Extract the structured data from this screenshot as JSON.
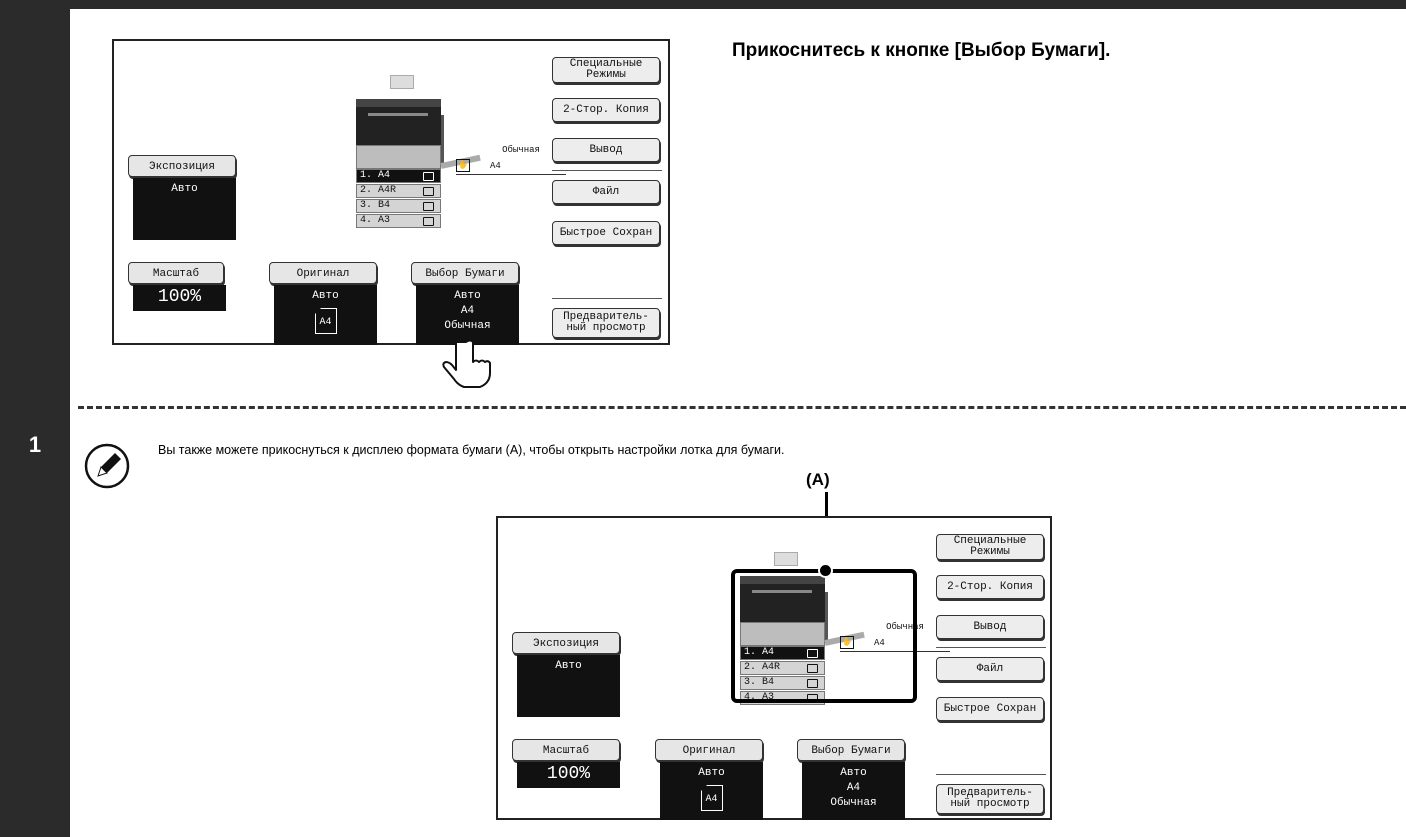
{
  "step_number": "1",
  "heading": "Прикоснитесь к кнопке [Выбор Бумаги].",
  "note_text": "Вы также можете прикоснуться к дисплею формата бумаги (A), чтобы открыть настройки лотка для бумаги.",
  "callout_label": "(A)",
  "panel": {
    "exposure_label": "Экспозиция",
    "exposure_value": "Авто",
    "scale_label": "Масштаб",
    "scale_value": "100%",
    "original_label": "Оригинал",
    "original_value": "Авто",
    "original_size": "A4",
    "paper_label": "Выбор Бумаги",
    "paper_value": "Авто",
    "paper_size": "A4",
    "paper_type": "Обычная",
    "paper_info_type": "Обычная",
    "paper_info_size": "A4",
    "trays": [
      "1.  A4",
      "2.  A4R",
      "3.  B4",
      "4.  A3"
    ],
    "buttons": {
      "special_1": "Специальные",
      "special_2": "Режимы",
      "duplex": "2-Стор. Копия",
      "output": "Вывод",
      "file": "Файл",
      "quick_save": "Быстрое Сохран",
      "preview_1": "Предваритель-",
      "preview_2": "ный просмотр"
    }
  }
}
